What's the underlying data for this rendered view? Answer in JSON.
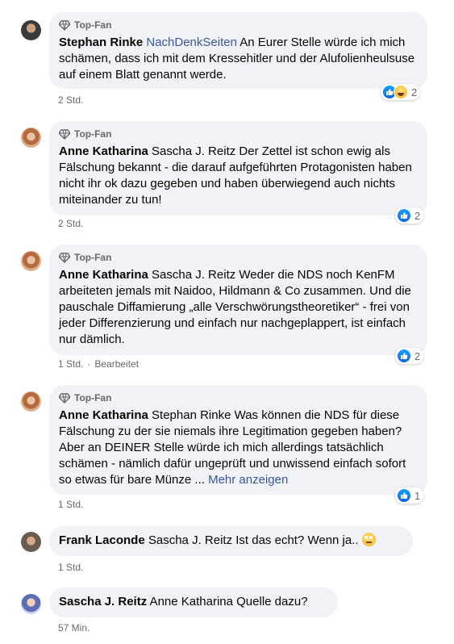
{
  "badge_label": "Top-Fan",
  "comments": [
    {
      "author": "Stephan Rinke",
      "mention": "NachDenkSeiten",
      "text": " An Eurer Stelle würde ich mich schämen, dass ich mit dem Kressehitler und der Alufolienheulsuse auf einem Blatt genannt werde.",
      "time": "2 Std.",
      "reaction_count": "2",
      "reactions": [
        "like-icon",
        "haha-icon"
      ]
    },
    {
      "author": "Anne Katharina",
      "text": " Sascha J. Reitz Der Zettel ist schon ewig als Fälschung bekannt - die darauf aufgeführten Protagonisten haben nicht ihr ok dazu gegeben und haben überwiegend auch nichts miteinander zu tun!",
      "time": "2 Std.",
      "reaction_count": "2",
      "reactions": [
        "like-icon"
      ]
    },
    {
      "author": "Anne Katharina",
      "text": " Sascha J. Reitz Weder die NDS noch KenFM arbeiteten jemals mit Naidoo, Hildmann & Co zusammen. Und die pauschale Diffamierung „alle Verschwörungstheoretiker“ - frei von jeder Differenzierung und einfach nur nachgeplappert, ist einfach nur dämlich.",
      "time": "1 Std.",
      "edited": "Bearbeitet",
      "reaction_count": "2",
      "reactions": [
        "like-icon"
      ]
    },
    {
      "author": "Anne Katharina",
      "text": " Stephan Rinke Was können die NDS für diese Fälschung zu der sie niemals ihre Legitimation gegeben haben? Aber an DEINER Stelle würde ich mich allerdings tatsächlich schämen - nämlich dafür ungeprüft und unwissend einfach sofort so etwas für bare Münze ... ",
      "more": "Mehr anzeigen",
      "time": "1 Std.",
      "reaction_count": "1",
      "reactions": [
        "like-icon"
      ]
    },
    {
      "author": "Frank Laconde",
      "text": " Sascha J. Reitz Ist das echt? Wenn ja..",
      "time": "1 Std.",
      "emoji": "eye-roll-emoji"
    },
    {
      "author": "Sascha J. Reitz",
      "text": " Anne Katharina Quelle dazu?",
      "time": "57 Min."
    }
  ],
  "colors": {
    "bubble": "#f0f2f5",
    "meta": "#65676b",
    "link": "#385898",
    "like": "#1877f2"
  }
}
